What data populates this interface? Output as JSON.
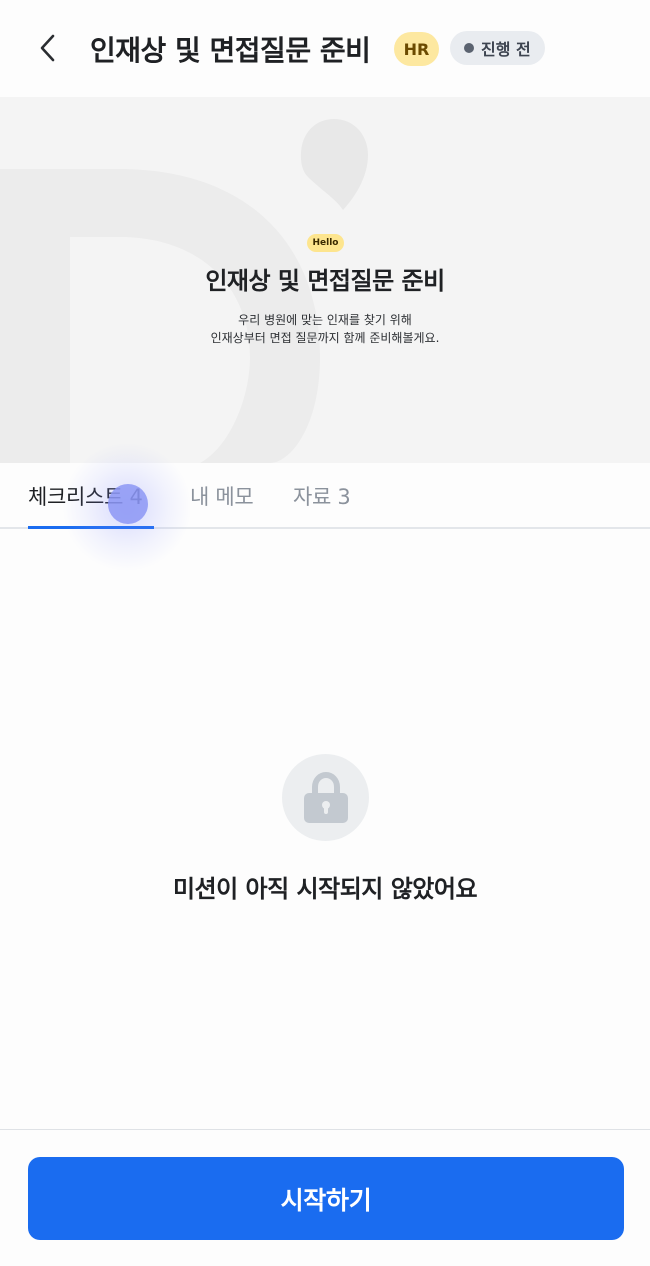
{
  "header": {
    "title": "인재상 및 면접질문 준비",
    "category_badge": "HR",
    "status_badge": "진행 전",
    "back_icon": "chevron-left-icon"
  },
  "hero": {
    "badge": "Hello",
    "title": "인재상 및 면접질문 준비",
    "description_line1": "우리 병원에 맞는 인재를 찾기 위해",
    "description_line2": "인재상부터 면접 질문까지 함께 준비해볼게요."
  },
  "tabs": [
    {
      "label": "체크리스트 4",
      "active": true
    },
    {
      "label": "내 메모",
      "active": false
    },
    {
      "label": "자료 3",
      "active": false
    }
  ],
  "empty_state": {
    "icon": "lock-icon",
    "message": "미션이 아직 시작되지 않았어요"
  },
  "footer": {
    "start_label": "시작하기"
  },
  "colors": {
    "accent": "#1a6cf0",
    "hr_badge_bg": "#fde8a0",
    "status_badge_bg": "#e9ecf0",
    "hello_badge_bg": "#fde58e"
  }
}
